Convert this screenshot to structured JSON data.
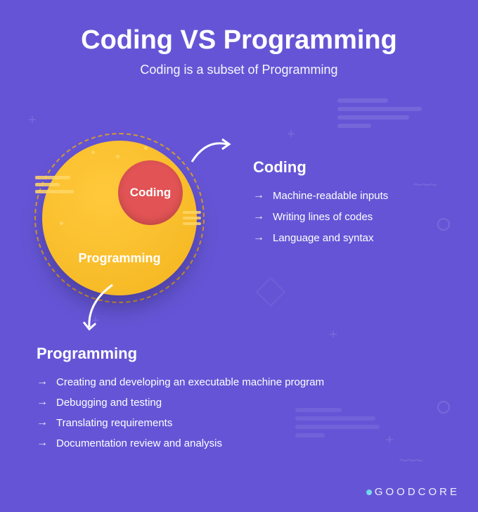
{
  "header": {
    "title": "Coding VS Programming",
    "subtitle": "Coding is a subset of Programming"
  },
  "venn": {
    "inner_label": "Coding",
    "outer_label": "Programming"
  },
  "coding": {
    "title": "Coding",
    "items": [
      "Machine-readable inputs",
      "Writing lines of codes",
      "Language and syntax"
    ]
  },
  "programming": {
    "title": "Programming",
    "items": [
      "Creating and developing an executable machine program",
      "Debugging and testing",
      "Translating requirements",
      "Documentation review and analysis"
    ]
  },
  "brand": "GOODCORE"
}
